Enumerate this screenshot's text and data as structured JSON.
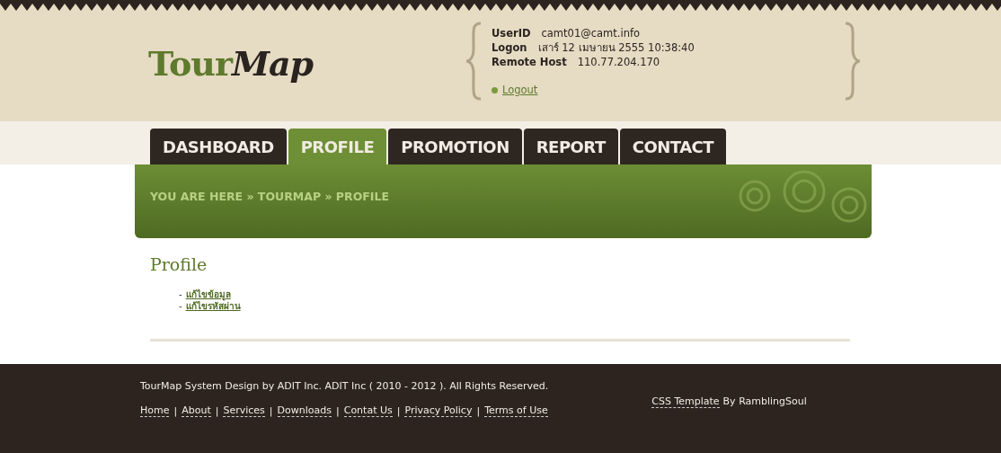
{
  "logo": {
    "plain": "Tour",
    "italic": "Map"
  },
  "user_info": [
    {
      "label": "UserID",
      "value": "camt01@camt.info"
    },
    {
      "label": "Logon",
      "value": "เสาร์ 12 เมษายน 2555 10:38:40"
    },
    {
      "label": "Remote Host",
      "value": "110.77.204.170"
    }
  ],
  "logout": "Logout",
  "tabs": [
    {
      "label": "DASHBOARD",
      "selected": false
    },
    {
      "label": "PROFILE",
      "selected": true
    },
    {
      "label": "PROMOTION",
      "selected": false
    },
    {
      "label": "REPORT",
      "selected": false
    },
    {
      "label": "CONTACT",
      "selected": false
    }
  ],
  "breadcrumb": "YOU ARE HERE » TOURMAP » PROFILE",
  "content": {
    "heading": "Profile",
    "links": [
      {
        "marker": "-",
        "label": "แก้ไขข้อมูล"
      },
      {
        "marker": "-",
        "label": "แก้ไขรหัสผ่าน"
      }
    ]
  },
  "footer": {
    "copyright": "TourMap System Design by ADIT Inc. ADIT Inc ( 2010 - 2012 ). All Rights Reserved.",
    "separator": "|",
    "links": [
      "Home",
      "About",
      "Services",
      "Downloads",
      "Contat Us",
      "Privacy Policy",
      "Terms of Use"
    ],
    "credit": {
      "link": "CSS Template",
      "text": "By RamblingSoul"
    }
  }
}
